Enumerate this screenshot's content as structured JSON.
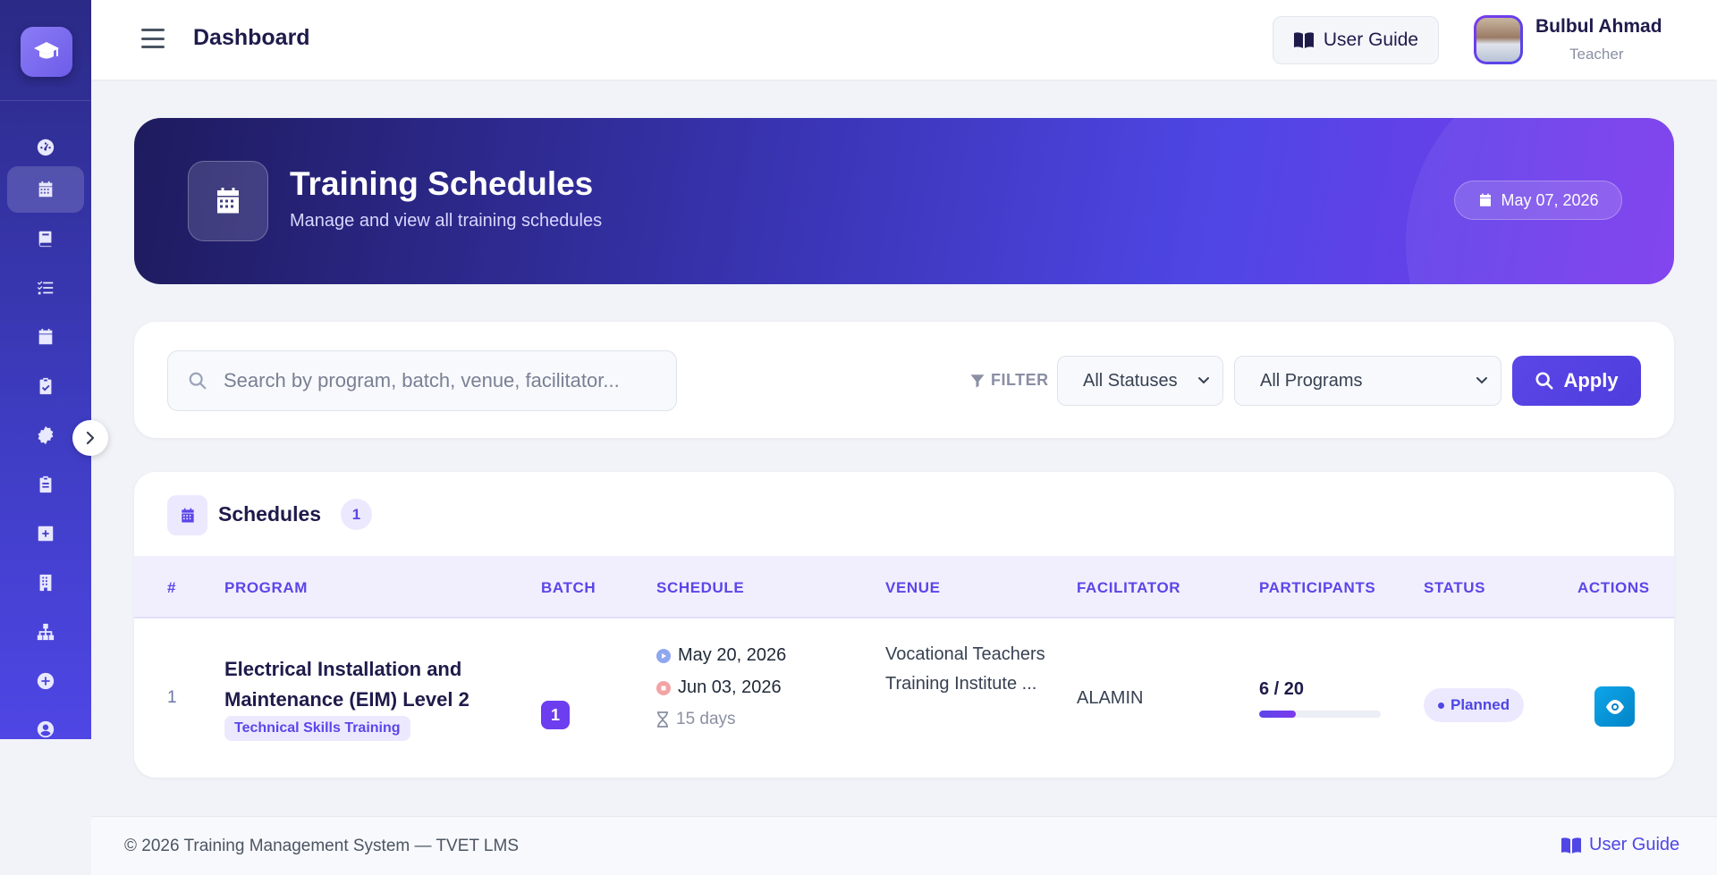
{
  "header": {
    "title": "Dashboard",
    "guide_label": "User Guide",
    "user_name": "Bulbul Ahmad",
    "user_role": "Teacher"
  },
  "sidebar": {
    "items": [
      {
        "icon": "dashboard-gauge-icon"
      },
      {
        "icon": "calendar-icon",
        "active": true
      },
      {
        "icon": "book-icon"
      },
      {
        "icon": "tasks-list-icon"
      },
      {
        "icon": "calendar-day-icon"
      },
      {
        "icon": "clipboard-check-icon"
      },
      {
        "icon": "certificate-icon"
      },
      {
        "icon": "clipboard-list-icon"
      },
      {
        "icon": "plus-square-icon"
      },
      {
        "icon": "building-icon"
      },
      {
        "icon": "sitemap-icon"
      },
      {
        "icon": "plus-circle-icon"
      },
      {
        "icon": "user-circle-icon"
      }
    ]
  },
  "hero": {
    "title": "Training Schedules",
    "subtitle": "Manage and view all training schedules",
    "date": "May 07, 2026"
  },
  "filters": {
    "search_placeholder": "Search by program, batch, venue, facilitator...",
    "filter_label": "FILTER",
    "status_selected": "All Statuses",
    "program_selected": "All Programs",
    "apply_label": "Apply"
  },
  "schedules": {
    "title": "Schedules",
    "count": "1",
    "columns": [
      "#",
      "PROGRAM",
      "BATCH",
      "SCHEDULE",
      "VENUE",
      "FACILITATOR",
      "PARTICIPANTS",
      "STATUS",
      "ACTIONS"
    ],
    "rows": [
      {
        "num": "1",
        "program": "Electrical Installation and Maintenance (EIM) Level 2",
        "category": "Technical Skills Training",
        "batch": "1",
        "start_date": "May 20, 2026",
        "end_date": "Jun 03, 2026",
        "duration": "15 days",
        "venue": "Vocational Teachers Training Institute ...",
        "facilitator": "ALAMIN",
        "participants": "6 / 20",
        "participants_fraction": 0.3,
        "status": "Planned"
      }
    ]
  },
  "footer": {
    "copyright": "© 2026 Training Management System — TVET LMS",
    "guide_label": "User Guide"
  },
  "colors": {
    "primary": "#4f46e5",
    "accent_purple": "#7c3aed",
    "sidebar_dark": "#2b2a86",
    "info_button": "#0ea5e9"
  }
}
